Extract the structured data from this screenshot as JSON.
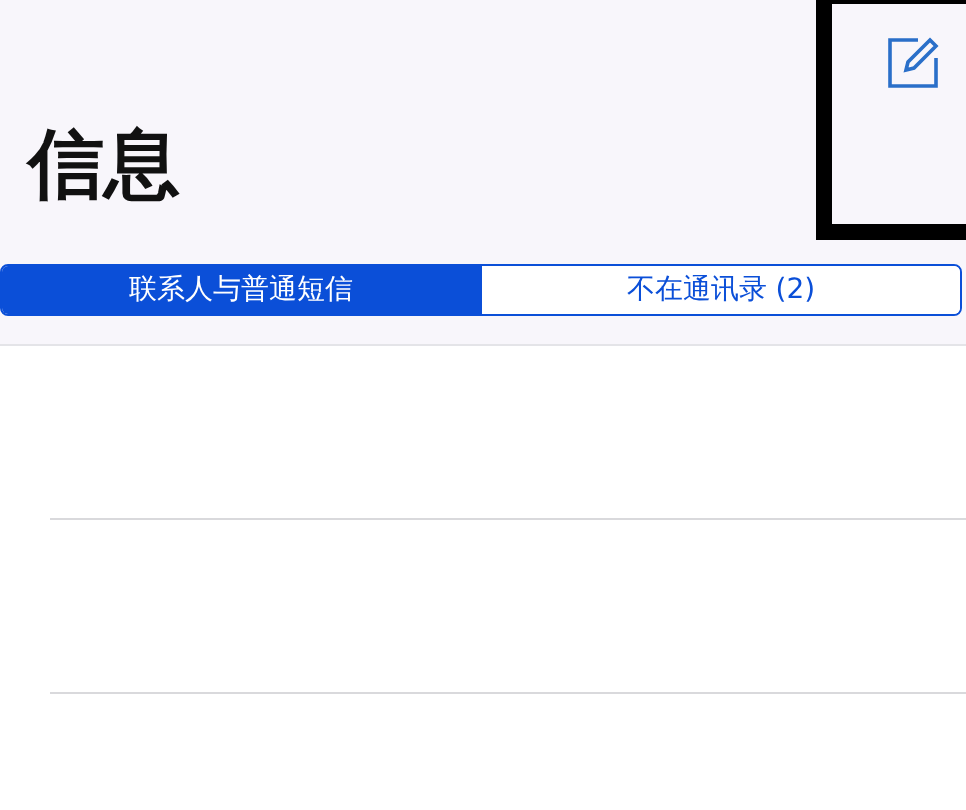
{
  "header": {
    "title": "信息",
    "highlight": {
      "kind": "box"
    }
  },
  "segments": [
    {
      "label": "联系人与普通短信",
      "selected": true
    },
    {
      "label": "不在通讯录 (2)",
      "selected": false
    }
  ]
}
